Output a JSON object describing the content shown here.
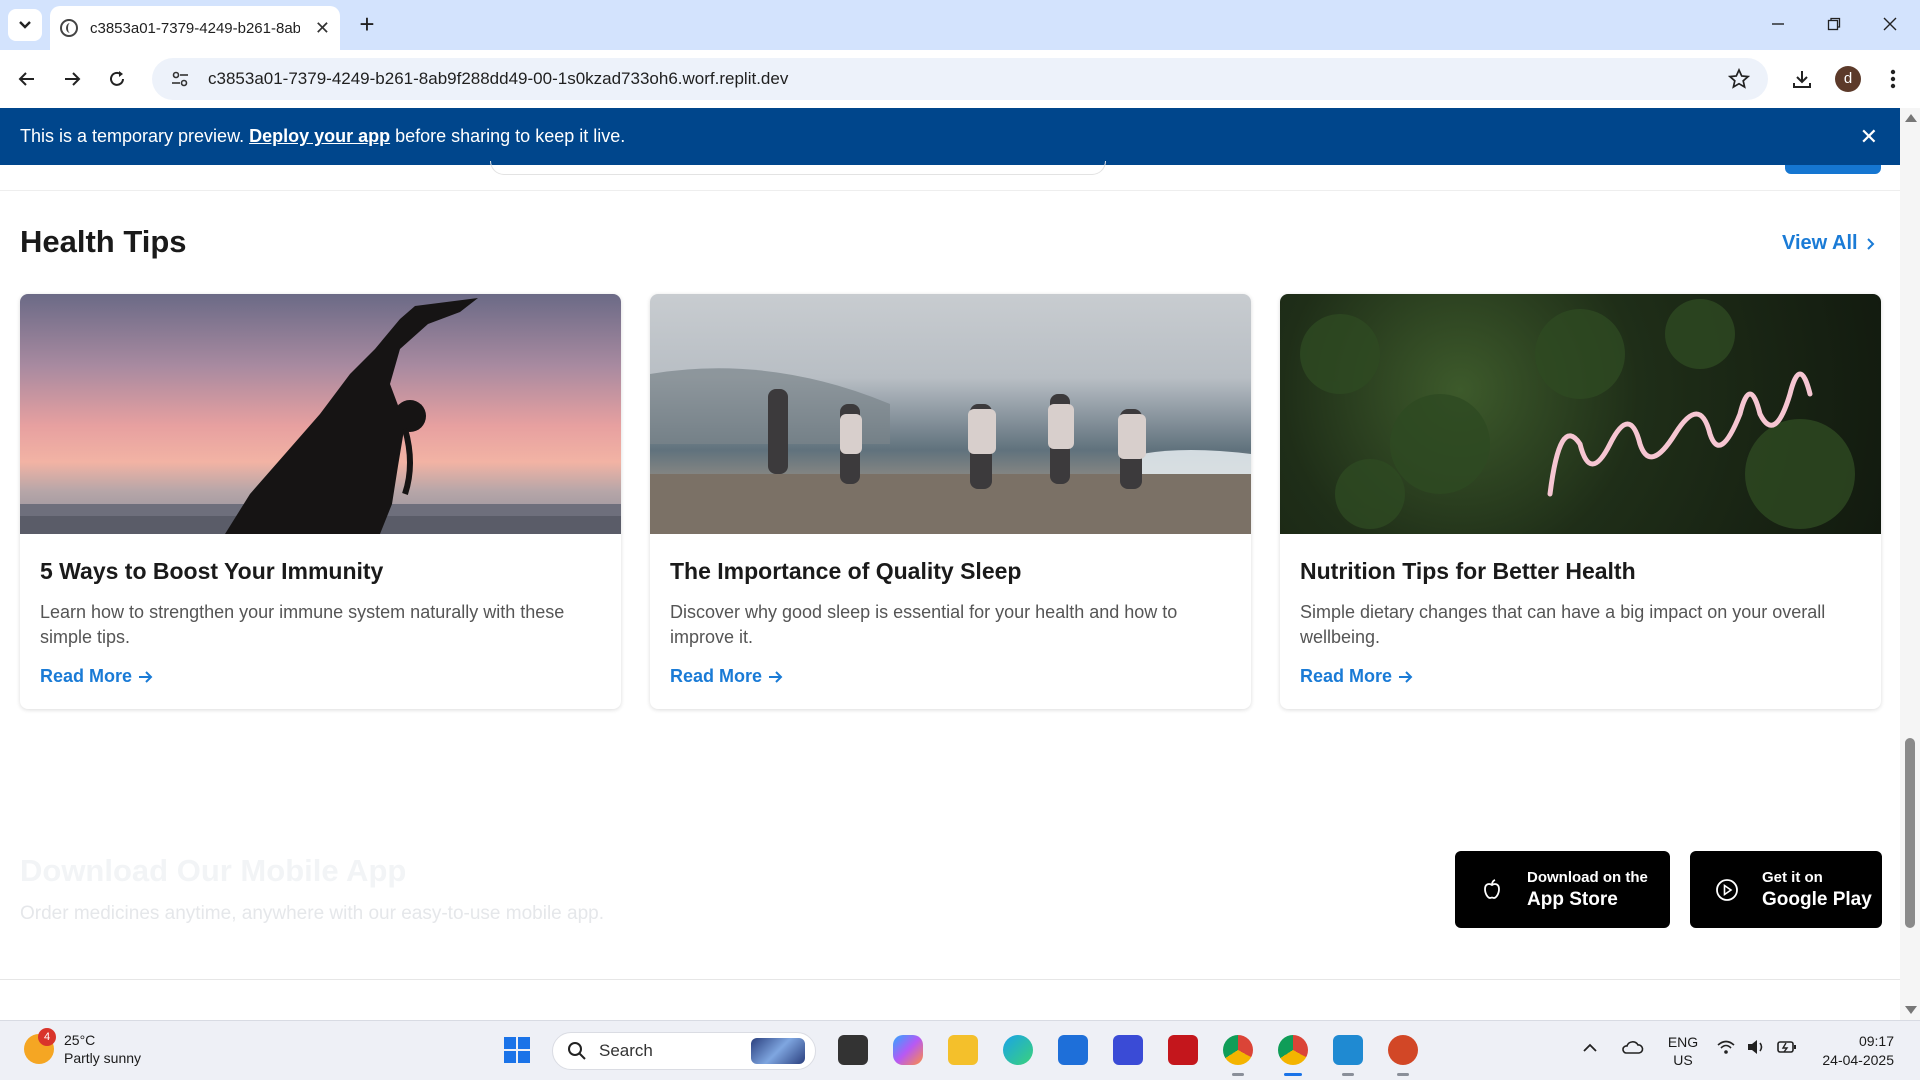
{
  "browser": {
    "tab_title": "c3853a01-7379-4249-b261-8ab9f288dd49",
    "url": "c3853a01-7379-4249-b261-8ab9f288dd49-00-1s0kzad733oh6.worf.replit.dev",
    "profile_initial": "d"
  },
  "banner": {
    "text_before": "This is a temporary preview.",
    "link": "Deploy your app",
    "text_after": "before sharing to keep it live."
  },
  "health_tips": {
    "title": "Health Tips",
    "view_all": "View All",
    "cards": [
      {
        "title": "5 Ways to Boost Your Immunity",
        "description": "Learn how to strengthen your immune system naturally with these simple tips.",
        "read_more": "Read More"
      },
      {
        "title": "The Importance of Quality Sleep",
        "description": "Discover why good sleep is essential for your health and how to improve it.",
        "read_more": "Read More"
      },
      {
        "title": "Nutrition Tips for Better Health",
        "description": "Simple dietary changes that can have a big impact on your overall wellbeing.",
        "read_more": "Read More"
      }
    ]
  },
  "download": {
    "title": "Download Our Mobile App",
    "subtitle": "Order medicines anytime, anywhere with our easy-to-use mobile app.",
    "app_store": {
      "small": "Download on the",
      "big": "App Store"
    },
    "google_play": {
      "small": "Get it on",
      "big": "Google Play"
    }
  },
  "taskbar": {
    "weather_temp": "25°C",
    "weather_desc": "Partly sunny",
    "weather_badge": "4",
    "search": "Search",
    "lang_top": "ENG",
    "lang_bottom": "US",
    "time": "09:17",
    "date": "24-04-2025"
  },
  "colors": {
    "accent": "#1a7bd6",
    "banner": "#00468c"
  }
}
